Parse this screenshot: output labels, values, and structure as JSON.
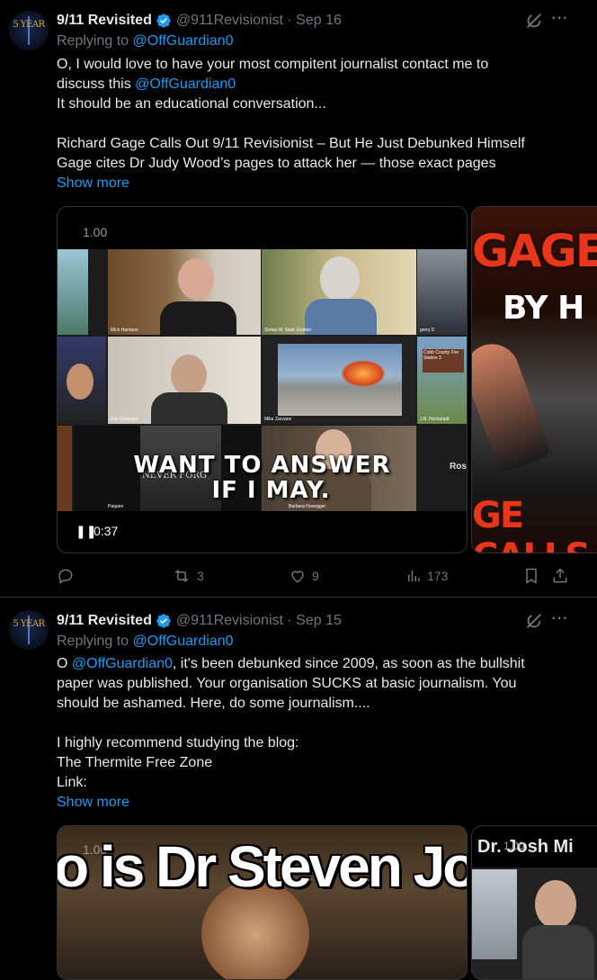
{
  "tweets": [
    {
      "author_name": "9/11 Revisited",
      "handle": "@911Revisionist",
      "date": "Sep 16",
      "avatar_text": "5 YEAR",
      "replying_label": "Replying to",
      "replying_to": "@OffGuardian0",
      "body": {
        "line1": "O, I would love to have your most compitent journalist contact me to",
        "line2_a": "discuss this ",
        "line2_link": "@OffGuardian0",
        "line3": "It should be an educational conversation...",
        "line4": "Richard Gage Calls Out 9/11 Revisionist – But He Just Debunked Himself",
        "line5": "Gage cites Dr Judy Wood’s pages to attack her — those exact pages",
        "show_more": "Show more"
      },
      "video": {
        "speed": "1.00",
        "caption_line1": "WANT TO ANSWER",
        "caption_line2": "IF I MAY.",
        "time": "0:37",
        "side_label": "Ros",
        "tiles": [
          "Mick Harrison",
          "Stefan M. Mark Scotton",
          "gerry D",
          "Eric Coverpot",
          "Mike Zarzano",
          "J.B. Hochstadt",
          "Paquee",
          "Barbara Honegger"
        ],
        "tile_sign": "Cobb County Fire Station 3",
        "sign_text": "NEVER FORG"
      },
      "thumb2": {
        "line1": "GAGE",
        "line2": "BY H",
        "line3": "GE CALLS"
      },
      "stats": {
        "replies": "",
        "reposts": "3",
        "likes": "9",
        "views": "173"
      }
    },
    {
      "author_name": "9/11 Revisited",
      "handle": "@911Revisionist",
      "date": "Sep 15",
      "avatar_text": "5 YEAR",
      "replying_label": "Replying to",
      "replying_to": "@OffGuardian0",
      "body": {
        "line1_a": "O ",
        "line1_link": "@OffGuardian0",
        "line1_b": ", it's been debunked since 2009, as soon as the bullshit",
        "line2": "paper was published. Your organisation SUCKS at basic journalism. You",
        "line3": "should be ashamed. Here, do some journalism....",
        "line4": "I highly recommend studying the blog:",
        "line5": "The Thermite Free Zone",
        "line6": "Link:",
        "show_more": "Show more"
      },
      "video": {
        "speed": "1.00",
        "title_text": "o is Dr Steven Jo"
      },
      "thumb2": {
        "title_text": "Dr. Josh Mi",
        "speed": "1.00"
      }
    }
  ],
  "colors": {
    "accent": "#1d9bf0",
    "muted": "#71767b",
    "text": "#e7e9ea",
    "bg": "#000000",
    "verified": "#1d9bf0"
  }
}
